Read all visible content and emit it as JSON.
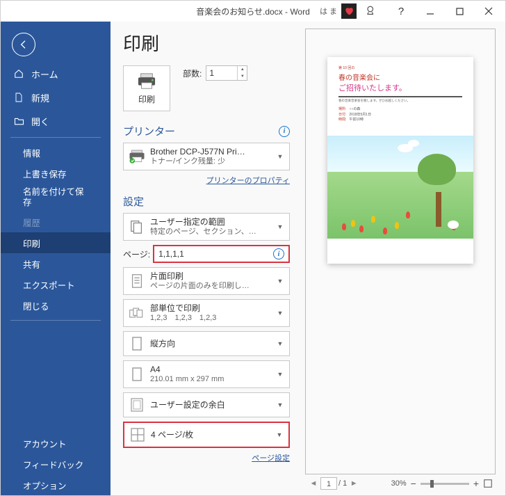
{
  "titlebar": {
    "title": "音楽会のお知らせ.docx - Word",
    "user": "は ま"
  },
  "sidebar": {
    "home": "ホーム",
    "new": "新規",
    "open": "開く",
    "info": "情報",
    "save": "上書き保存",
    "saveas": "名前を付けて保存",
    "history": "履歴",
    "print": "印刷",
    "share": "共有",
    "export": "エクスポート",
    "close": "閉じる",
    "account": "アカウント",
    "feedback": "フィードバック",
    "options": "オプション"
  },
  "print": {
    "title": "印刷",
    "button": "印刷",
    "copies_label": "部数:",
    "copies_value": "1"
  },
  "printer": {
    "heading": "プリンター",
    "name": "Brother DCP-J577N Pri…",
    "status": "トナー/インク残量: 少",
    "props_link": "プリンターのプロパティ"
  },
  "settings": {
    "heading": "設定",
    "range": {
      "title": "ユーザー指定の範囲",
      "sub": "特定のページ、セクション、…"
    },
    "pages_label": "ページ:",
    "pages_value": "1,1,1,1",
    "sides": {
      "title": "片面印刷",
      "sub": "ページの片面のみを印刷し…"
    },
    "collate": {
      "title": "部単位で印刷",
      "sub": "1,2,3　1,2,3　1,2,3"
    },
    "orient": {
      "title": "縦方向"
    },
    "size": {
      "title": "A4",
      "sub": "210.01 mm x 297 mm"
    },
    "margins": {
      "title": "ユーザー設定の余白"
    },
    "perpage": {
      "title": "4 ページ/枚"
    },
    "page_setup_link": "ページ設定"
  },
  "preview": {
    "doc_smallred": "第 10 回の",
    "doc_line1": "春の音楽会に",
    "doc_line2": "ご招待いたします。",
    "doc_tagline": "春の音楽音楽会を催します。ぜひお越しください。",
    "doc_place_lbl": "場所:",
    "doc_place": "○○の森",
    "doc_date_lbl": "日付:",
    "doc_date": "2018年5月1日",
    "doc_time_lbl": "時間:",
    "doc_time": "午前10時",
    "page_current": "1",
    "page_total": "1",
    "zoom": "30%"
  }
}
